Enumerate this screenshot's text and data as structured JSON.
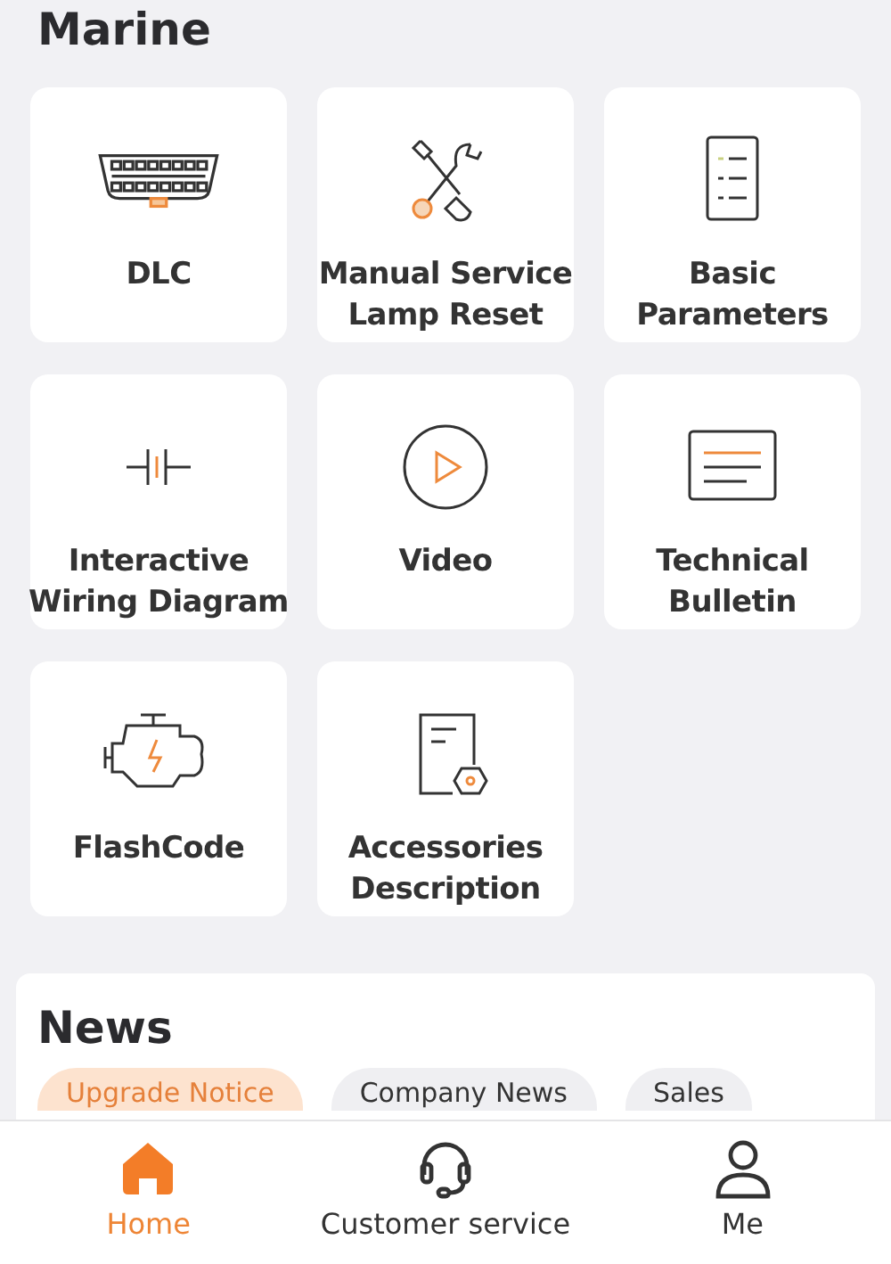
{
  "section_title": "Marine",
  "tiles": [
    {
      "kind": "connector",
      "label": "DLC"
    },
    {
      "kind": "tools",
      "label": "Manual Service Lamp Reset"
    },
    {
      "kind": "list",
      "label": "Basic Parameters"
    },
    {
      "kind": "wiring",
      "label": "Interactive Wiring Diagram"
    },
    {
      "kind": "video",
      "label": "Video"
    },
    {
      "kind": "bulletin",
      "label": "Technical Bulletin"
    },
    {
      "kind": "engine",
      "label": "FlashCode"
    },
    {
      "kind": "accessory",
      "label": "Accessories Description"
    }
  ],
  "news": {
    "title": "News",
    "chips": [
      {
        "label": "Upgrade Notice",
        "selected": true
      },
      {
        "label": "Company News",
        "selected": false
      },
      {
        "label": "Sales",
        "selected": false
      }
    ]
  },
  "bottom_nav": [
    {
      "kind": "home",
      "label": "Home",
      "selected": true
    },
    {
      "kind": "headset",
      "label": "Customer service",
      "selected": false
    },
    {
      "kind": "person",
      "label": "Me",
      "selected": false
    }
  ]
}
